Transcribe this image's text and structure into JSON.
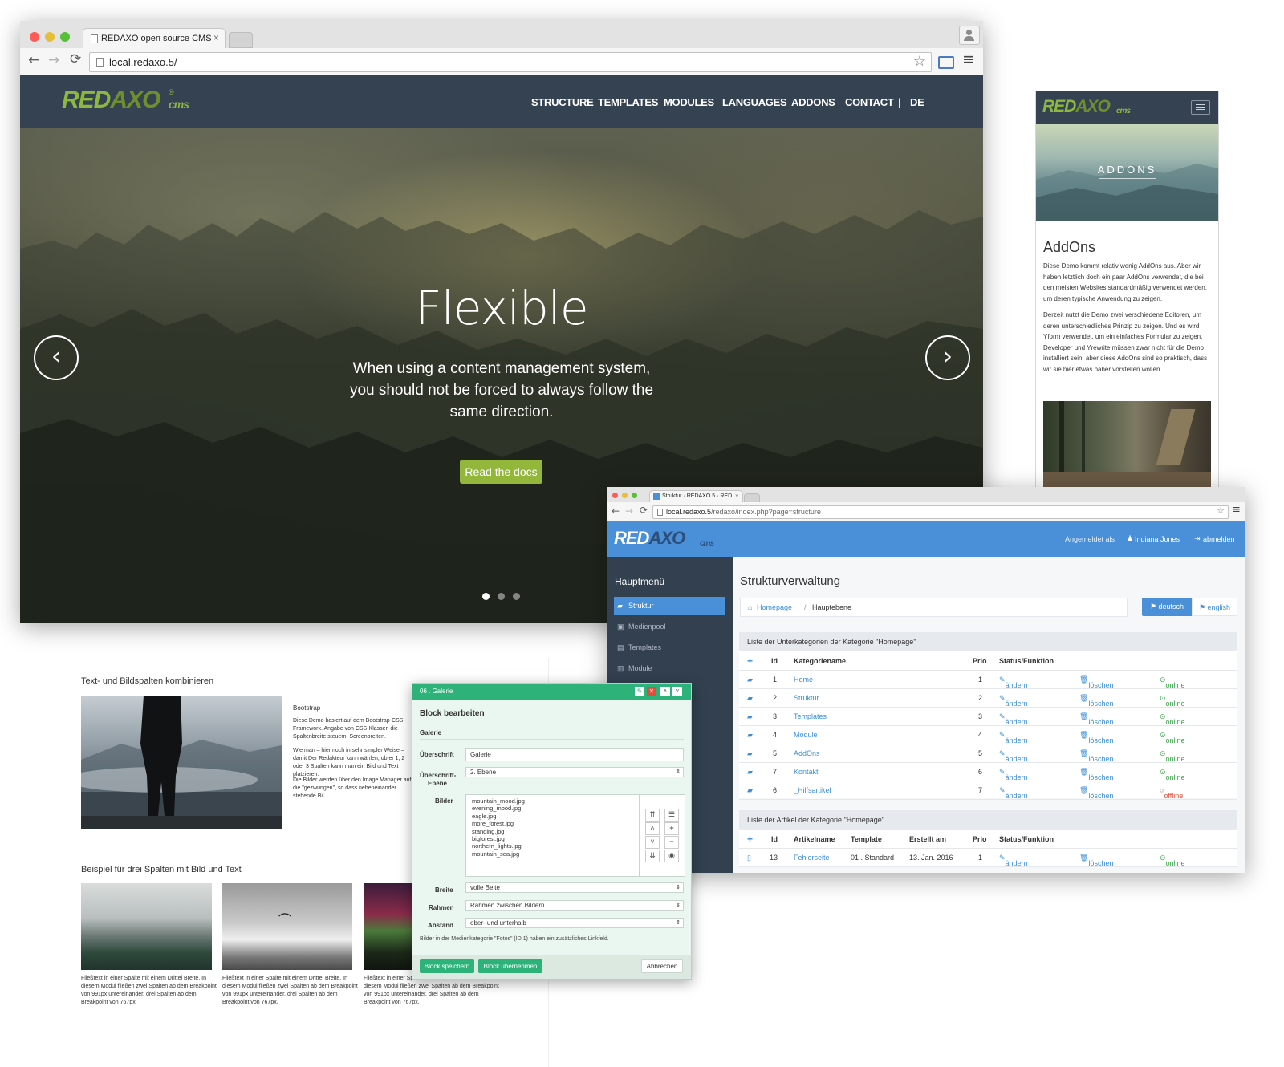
{
  "main_browser": {
    "tab_title": "REDAXO open source CMS",
    "tab_close": "×",
    "url": "local.redaxo.5/",
    "back": "←",
    "forward": "→",
    "reload": "C",
    "star": "☆",
    "menu": "≡"
  },
  "site": {
    "logo_red": "RED",
    "logo_axo": "AXO",
    "logo_cms": "cms",
    "logo_reg": "®",
    "nav": [
      "STRUCTURE",
      "TEMPLATES",
      "MODULES",
      "LANGUAGES",
      "ADDONS",
      "CONTACT",
      "|",
      "DE"
    ],
    "hero": {
      "title": "Flexible",
      "text_line1": "When using a content management system,",
      "text_line2": "you should not be forced to always follow the",
      "text_line3": "same direction.",
      "button": "Read the docs",
      "prev": "‹",
      "next": "›",
      "slides": 3,
      "active_slide": 1
    }
  },
  "mobile": {
    "logo_red": "RED",
    "logo_axo": "AXO",
    "logo_cms": "cms",
    "hero_label": "ADDONS",
    "heading": "AddOns",
    "para1": "Diese Demo kommt relativ wenig AddOns aus. Aber wir haben letztlich doch ein paar AddOns verwendet, die bei den meisten Websites standardmäßig verwendet werden, um deren typische Anwendung zu zeigen.",
    "para2": "Derzeit nutzt die Demo zwei verschiedene Editoren, um deren unterschiedliches Prinzip zu zeigen. Und es wird Yform verwendet, um ein einfaches Formular zu zeigen. Developer und Yrewrite müssen zwar nicht für die Demo installiert sein, aber diese AddOns sind so praktisch, dass wir sie hier etwas näher vorstellen wollen."
  },
  "doc": {
    "heading1": "Text- und Bildspalten kombinieren",
    "bootstrap_title": "Bootstrap",
    "bootstrap_p1": "Diese Demo basiert auf dem Bootstrap-CSS-Framework. Angabe von CSS-Klassen die Spaltenbreite steuern. Screenbreiten.",
    "bootstrap_p2": "Wie man – hier noch in sehr simpler Weise – damit Der Redakteur kann wählen, ob er 1, 2 oder 3 Spalten kann man ein Bild und Text platzieren.",
    "bootstrap_p3": "Die Bilder werden über den Image Manager auf die \"gezwungen\", so dass nebeneinander stehende Bil",
    "heading2": "Beispiel für drei Spalten mit Bild und Text",
    "col_text_l1": "Fließtext in einer Spalte mit einem Drittel Breite. In",
    "col_text_l2": "diesem Modul fließen zwei Spalten ab dem Breakpoint",
    "col_text_l3": "von 991px untereinander, drei Spalten ab dem",
    "col_text_l4": "Breakpoint von 767px."
  },
  "block_editor": {
    "header": "06 . Galerie",
    "title": "Block bearbeiten",
    "subtitle": "Galerie",
    "label_ueberschrift": "Überschrift",
    "value_ueberschrift": "Galerie",
    "label_ebene_1": "Überschrift-",
    "label_ebene_2": "Ebene",
    "value_ebene": "2. Ebene",
    "label_bilder": "Bilder",
    "images": [
      "mountain_mood.jpg",
      "evening_mood.jpg",
      "eagle.jpg",
      "more_forest.jpg",
      "standing.jpg",
      "bigforest.jpg",
      "northern_lights.jpg",
      "mountain_sea.jpg"
    ],
    "label_breite": "Breite",
    "value_breite": "volle Beite",
    "label_rahmen": "Rahmen",
    "value_rahmen": "Rahmen zwischen Bildern",
    "label_abstand": "Abstand",
    "value_abstand": "ober- und unterhalb",
    "note": "Bilder in der Medienkategorie \"Fotos\" (ID 1) haben ein zusätzliches Linkfeld.",
    "save": "Block speichern",
    "apply": "Block übernehmen",
    "cancel": "Abbrechen"
  },
  "backend": {
    "tab_title": "Struktur · REDAXO 5 · RED",
    "url_host": "local.redaxo.5",
    "url_path": "/redaxo/index.php?page=structure",
    "logo_red": "RED",
    "logo_axo": "AXO",
    "logo_cms": "cms",
    "logged_in_label": "Angemeldet als",
    "user": "Indiana Jones",
    "logout": "abmelden",
    "sidebar_title": "Hauptmenü",
    "sidebar": [
      "Struktur",
      "Medienpool",
      "Templates",
      "Module"
    ],
    "page_title": "Strukturverwaltung",
    "breadcrumb_home": "Homepage",
    "breadcrumb_sep": "/",
    "breadcrumb_current": "Hauptebene",
    "lang_de": "deutsch",
    "lang_en": "english",
    "categories_panel": "Liste der Unterkategorien der Kategorie \"Homepage\"",
    "cat_headers": {
      "add": "+",
      "id": "Id",
      "name": "Kategoriename",
      "prio": "Prio",
      "status": "Status/Funktion"
    },
    "categories": [
      {
        "id": "1",
        "name": "Home",
        "prio": "1",
        "edit": "ändern",
        "delete": "löschen",
        "status": "online"
      },
      {
        "id": "2",
        "name": "Struktur",
        "prio": "2",
        "edit": "ändern",
        "delete": "löschen",
        "status": "online"
      },
      {
        "id": "3",
        "name": "Templates",
        "prio": "3",
        "edit": "ändern",
        "delete": "löschen",
        "status": "online"
      },
      {
        "id": "4",
        "name": "Module",
        "prio": "4",
        "edit": "ändern",
        "delete": "löschen",
        "status": "online"
      },
      {
        "id": "5",
        "name": "AddOns",
        "prio": "5",
        "edit": "ändern",
        "delete": "löschen",
        "status": "online"
      },
      {
        "id": "7",
        "name": "Kontakt",
        "prio": "6",
        "edit": "ändern",
        "delete": "löschen",
        "status": "online"
      },
      {
        "id": "6",
        "name": "_Hilfsartikel",
        "prio": "7",
        "edit": "ändern",
        "delete": "löschen",
        "status": "offline"
      }
    ],
    "articles_panel": "Liste der Artikel der Kategorie \"Homepage\"",
    "art_headers": {
      "add": "+",
      "id": "Id",
      "name": "Artikelname",
      "template": "Template",
      "created": "Erstellt am",
      "prio": "Prio",
      "status": "Status/Funktion"
    },
    "articles": [
      {
        "id": "13",
        "name": "Fehlerseite",
        "template": "01 . Standard",
        "created": "13. Jan. 2016",
        "prio": "1",
        "edit": "ändern",
        "delete": "löschen",
        "status": "online"
      }
    ]
  },
  "colors": {
    "redaxo_green": "#8cb83f",
    "site_header": "#344252",
    "backend_blue": "#4a90d9",
    "backend_sidebar": "#324050",
    "block_header": "#2db37a"
  }
}
